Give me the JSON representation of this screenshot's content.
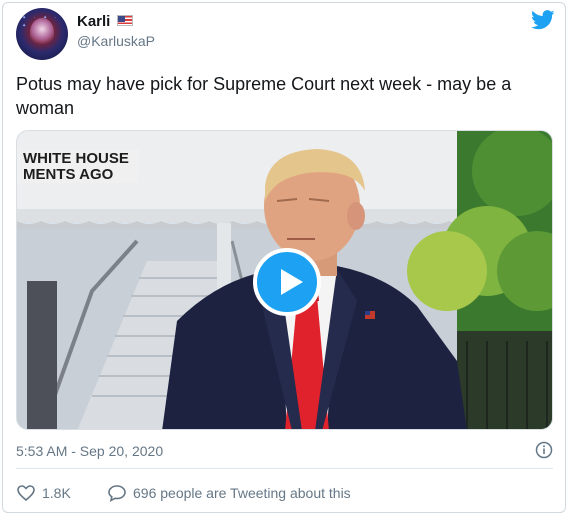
{
  "tweet": {
    "author_name": "Karli",
    "author_handle": "@KarluskaP",
    "text": "Potus may have pick for Supreme Court next week - may be a woman",
    "timestamp": "5:53 AM - Sep 20, 2020",
    "media": {
      "chyron_line1": "WHITE HOUSE",
      "chyron_line2": "MENTS AGO"
    },
    "likes": "1.8K",
    "conversation": "696 people are Tweeting about this"
  },
  "icons": {
    "platform": "twitter-bird-icon",
    "flag": "us-flag-icon",
    "info": "info-icon",
    "like": "heart-icon",
    "reply": "speech-bubble-icon",
    "play": "play-icon"
  },
  "colors": {
    "brand": "#1da1f2",
    "text": "#14171a",
    "muted": "#657786",
    "border": "#cfd9de",
    "tie": "#e0222d"
  }
}
